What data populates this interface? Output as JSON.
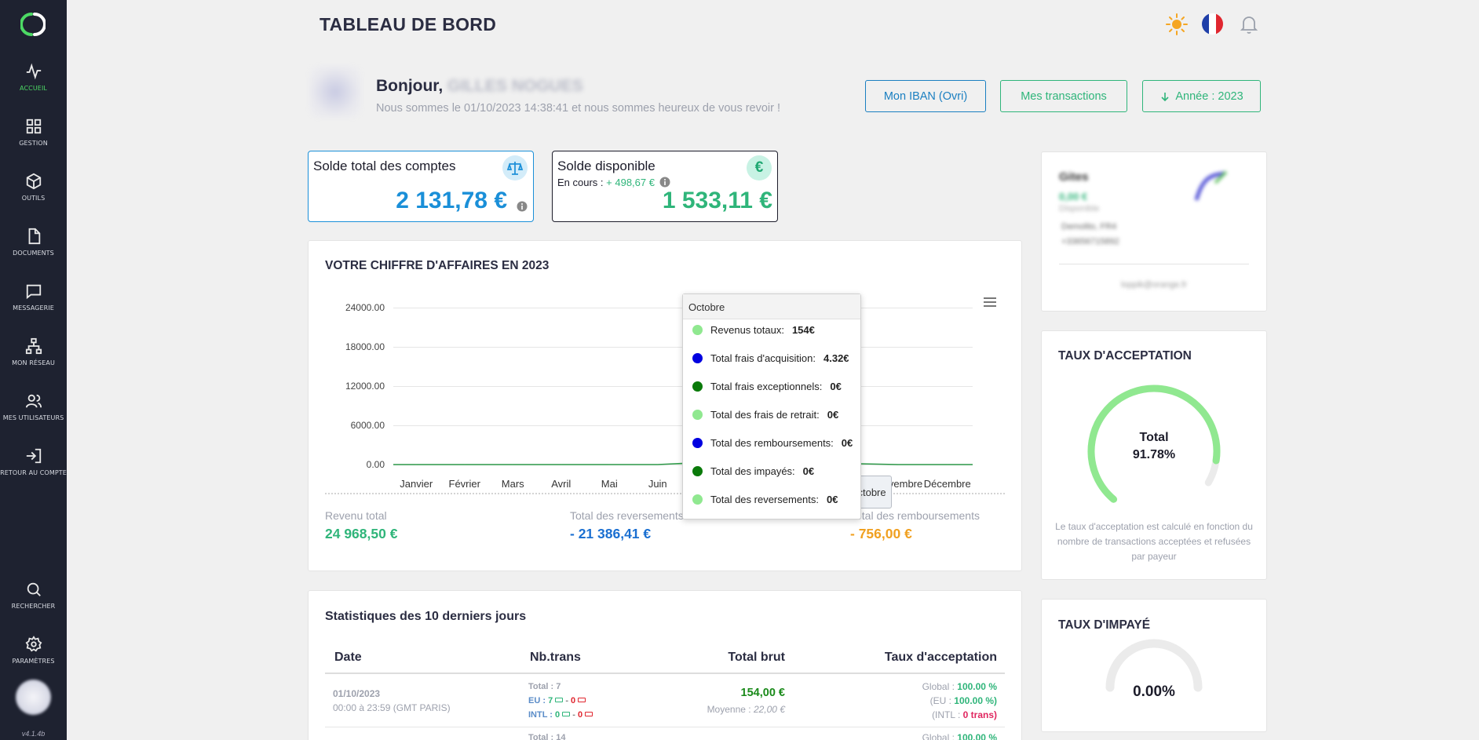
{
  "sidebar": {
    "items": [
      {
        "label": "ACCUEIL"
      },
      {
        "label": "GESTION"
      },
      {
        "label": "OUTILS"
      },
      {
        "label": "DOCUMENTS"
      },
      {
        "label": "MESSAGERIE"
      },
      {
        "label": "MON RÉSEAU"
      },
      {
        "label": "MES UTILISATEURS"
      },
      {
        "label": "RETOUR AU COMPTE"
      }
    ],
    "bottom_items": [
      {
        "label": "RECHERCHER"
      },
      {
        "label": "PARAMÈTRES"
      }
    ],
    "version": "v4.1.4b"
  },
  "header": {
    "title": "TABLEAU DE BORD",
    "icons": [
      "sun-icon",
      "french-flag-icon",
      "bell-icon"
    ]
  },
  "greeting": {
    "hello": "Bonjour,",
    "name": "GILLES NOGUES",
    "subtitle": "Nous sommes le 01/10/2023 14:38:41 et nous sommes heureux de vous revoir !"
  },
  "actions": {
    "iban_label": "Mon IBAN (Ovri)",
    "transactions_label": "Mes transactions",
    "year_label": "Année : 2023"
  },
  "balances": {
    "total": {
      "title": "Solde total des comptes",
      "amount": "2 131,78 €"
    },
    "available": {
      "title": "Solde disponible",
      "pending_label": "En cours :",
      "pending_value": "+ 498,67 €",
      "amount": "1 533,11 €"
    }
  },
  "revenue": {
    "title": "VOTRE CHIFFRE D'AFFAIRES EN 2023",
    "summary": [
      {
        "label": "Revenu total",
        "value": "24 968,50 €",
        "color": "#2fb57a"
      },
      {
        "label": "Total des reversements",
        "value": "- 21 386,41 €",
        "color": "#1a6fd1"
      },
      {
        "label": "Total des remboursements",
        "value": "- 756,00 €",
        "color": "#f0a020"
      }
    ],
    "tooltip": {
      "month": "Octobre",
      "rows": [
        {
          "label": "Revenus totaux:",
          "value": "154€",
          "color": "#90e890"
        },
        {
          "label": "Total frais d'acquisition:",
          "value": "4.32€",
          "color": "#0000e0"
        },
        {
          "label": "Total frais exceptionnels:",
          "value": "0€",
          "color": "#0a7a0a"
        },
        {
          "label": "Total des frais de retrait:",
          "value": "0€",
          "color": "#90e890"
        },
        {
          "label": "Total des remboursements:",
          "value": "0€",
          "color": "#0000e0"
        },
        {
          "label": "Total des impayés:",
          "value": "0€",
          "color": "#0a7a0a"
        },
        {
          "label": "Total des reversements:",
          "value": "0€",
          "color": "#90e890"
        }
      ]
    },
    "hover_label": "Octobre"
  },
  "chart_data": {
    "type": "area",
    "categories": [
      "Janvier",
      "Février",
      "Mars",
      "Avril",
      "Mai",
      "Juin",
      "Juillet",
      "Août",
      "Septembre",
      "Octobre",
      "Novembre",
      "Décembre"
    ],
    "y_ticks": [
      "0.00",
      "6000.00",
      "12000.00",
      "18000.00",
      "24000.00"
    ],
    "ylim": [
      0,
      24000
    ],
    "series": [
      {
        "name": "Revenus totaux",
        "values": [
          0,
          0,
          0,
          0,
          0,
          0,
          350,
          600,
          300,
          154,
          0,
          0
        ]
      }
    ],
    "grid": true,
    "title": "VOTRE CHIFFRE D'AFFAIRES EN 2023"
  },
  "stats": {
    "title": "Statistiques des 10 derniers jours",
    "columns": [
      "Date",
      "Nb.trans",
      "Total brut",
      "Taux d'acceptation"
    ],
    "rows": [
      {
        "date": "01/10/2023",
        "time": "00:00 à 23:59 (GMT PARIS)",
        "total_label": "Total : 7",
        "eu_label": "EU :",
        "eu_ok": "7",
        "eu_ko": "0",
        "intl_label": "INTL :",
        "intl_ok": "0",
        "intl_ko": "0",
        "gross": "154,00 €",
        "avg_label": "Moyenne :",
        "avg": "22,00 €",
        "global_label": "Global :",
        "global": "100.00 %",
        "eu_rate_label": "(EU :",
        "eu_rate": "100.00 %)",
        "intl_rate_label": "(INTL :",
        "intl_rate": "0 trans)"
      },
      {
        "total_label": "Total : 14",
        "global_label": "Global :",
        "global": "100.00 %"
      }
    ]
  },
  "merchant": {
    "name": "Gites",
    "amount": "0,00 €",
    "sub": "Disponible",
    "address": "Demolito, FR4",
    "phone": "+33656715892",
    "email": "loppik@orange.fr"
  },
  "acceptance": {
    "title": "TAUX D'ACCEPTATION",
    "label": "Total",
    "value": "91.78%",
    "note": "Le taux d'acceptation est calculé en fonction du nombre de transactions acceptées et refusées par payeur"
  },
  "unpaid": {
    "title": "TAUX D'IMPAYÉ",
    "value": "0.00%"
  }
}
